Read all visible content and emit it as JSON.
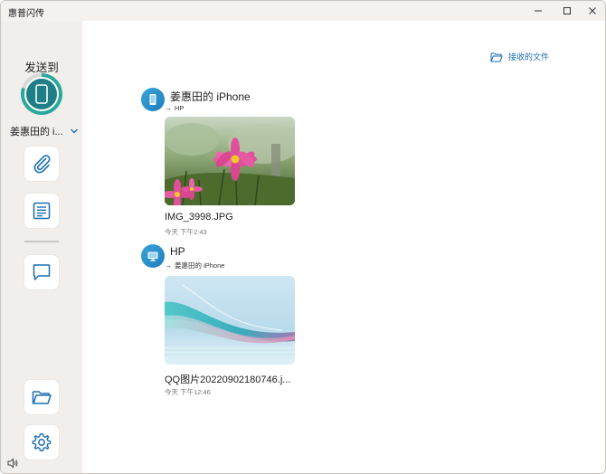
{
  "window": {
    "title": "惠普闪传"
  },
  "sidebar": {
    "send_to_label": "发送到",
    "device_name": "姜惠田的 i...",
    "device_progress": 0.8,
    "buttons": [
      {
        "icon": "paperclip-icon"
      },
      {
        "icon": "document-icon"
      },
      {
        "icon": "chat-icon"
      },
      {
        "icon": "folder-icon"
      },
      {
        "icon": "gear-icon"
      }
    ]
  },
  "header": {
    "received_files_label": "接收的文件"
  },
  "messages": [
    {
      "sender": "姜惠田的 iPhone",
      "recipient": "HP",
      "file_name": "IMG_3998.JPG",
      "time": "今天 下午2:43",
      "avatar_icon": "phone-icon"
    },
    {
      "sender": "HP",
      "recipient": "姜惠田的 iPhone",
      "file_name": "QQ图片20220902180746.j...",
      "time": "今天 下午12:46",
      "avatar_icon": "monitor-icon"
    }
  ],
  "colors": {
    "accent": "#1a6fb3",
    "ring": "#29a99a",
    "sidebar_bg": "#f1eeeb"
  }
}
